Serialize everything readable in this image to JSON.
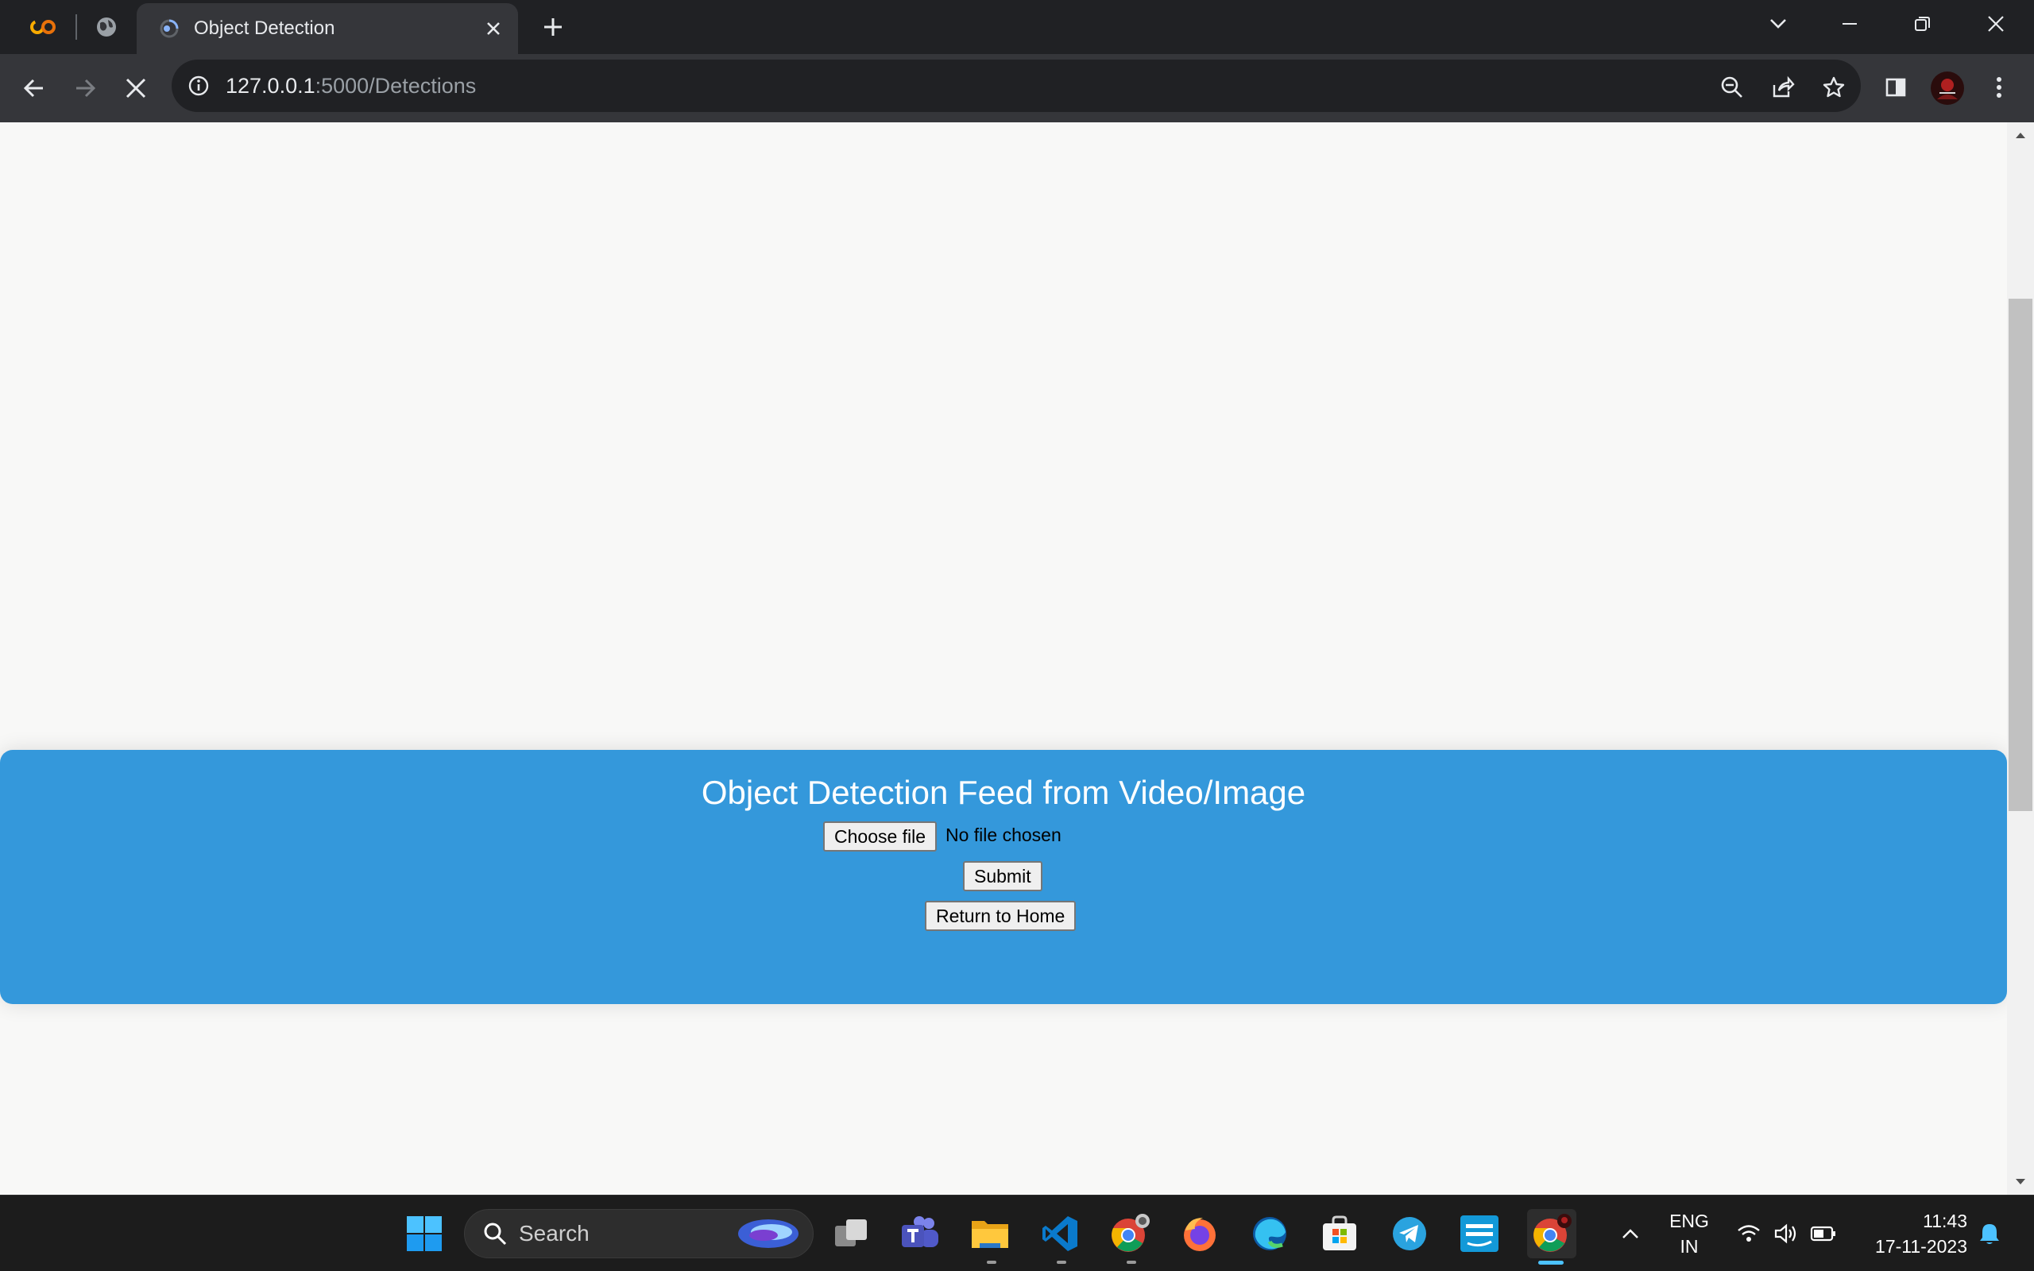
{
  "browser": {
    "tab_title": "Object Detection",
    "url_host": "127.0.0.1",
    "url_rest": ":5000/Detections"
  },
  "page": {
    "heading": "Object Detection Feed from Video/Image",
    "choose_file_label": "Choose file",
    "file_status": "No file chosen",
    "submit_label": "Submit",
    "return_label": "Return to Home",
    "panel_color": "#3498db"
  },
  "taskbar": {
    "search_label": "Search",
    "language_line1": "ENG",
    "language_line2": "IN",
    "time": "11:43",
    "date": "17-11-2023"
  }
}
